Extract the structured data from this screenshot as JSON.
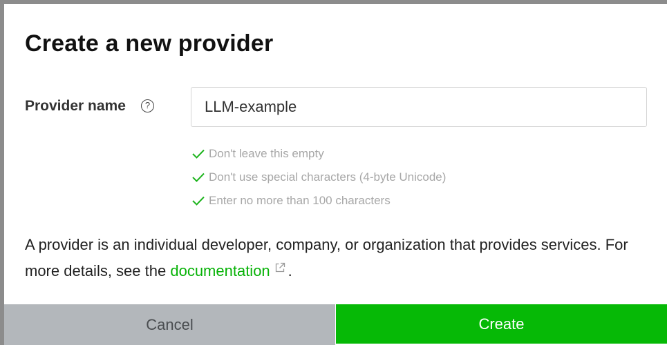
{
  "dialog": {
    "title": "Create a new provider",
    "field_label": "Provider name",
    "help_icon": "question-circle-icon",
    "input_value": "LLM-example",
    "validations": [
      {
        "icon": "check-icon",
        "text": "Don't leave this empty"
      },
      {
        "icon": "check-icon",
        "text": "Don't use special characters (4-byte Unicode)"
      },
      {
        "icon": "check-icon",
        "text": "Enter no more than 100 characters"
      }
    ],
    "description_before": "A provider is an individual developer, company, or organization that provides services. For more details, see the ",
    "link_text": "documentation",
    "link_icon": "external-link-icon",
    "description_after": ".",
    "cancel_label": "Cancel",
    "create_label": "Create"
  },
  "colors": {
    "accent_green": "#06b906",
    "link_green": "#06b206",
    "check_green": "#1db41d",
    "cancel_bg": "#b3b7bb",
    "validation_text": "#a7a7a7"
  }
}
